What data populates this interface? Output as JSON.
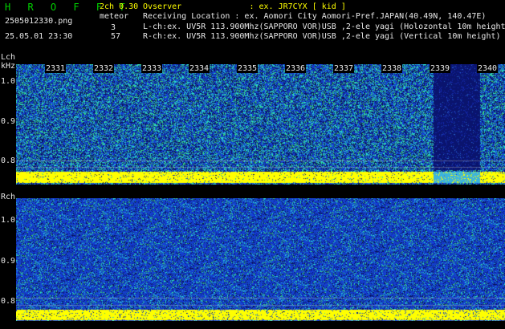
{
  "header": {
    "title": "H R O F F T",
    "mode": "2ch 0.30",
    "filename": "2505012330.png",
    "meteor_label": "meteor",
    "meteor_l": "3",
    "meteor_r": "57",
    "datetime": "25.05.01 23:30",
    "info_lines": [
      "Ovserver              : ex. JR7CYX [ kid ]",
      "Receiving Location : ex. Aomori City Aomori-Pref.JAPAN(40.49N, 140.47E)",
      "L-ch:ex. UV5R 113.900Mhz(SAPPORO VOR)USB ,2-ele yagi (Holozontal 10m height)",
      "R-ch:ex. UV5R 113.900Mhz(SAPPORO VOR)USB ,2-ele yagi (Vertical 10m height)"
    ]
  },
  "lch": {
    "label": "Lch",
    "unit": "kHz",
    "y_ticks": [
      "1.0",
      "0.9",
      "0.8"
    ],
    "x_ticks": [
      "2331",
      "2332",
      "2333",
      "2334",
      "2335",
      "2336",
      "2337",
      "2338",
      "2339",
      "2340"
    ]
  },
  "rch": {
    "label": "Rch",
    "y_ticks": [
      "1.0",
      "0.9",
      "0.8"
    ]
  },
  "colors": {
    "accent_green": "#00d000",
    "meteor_yellow": "#ffff00",
    "noise_blue": "#1a3cc8",
    "noise_cyan": "#30d0c0"
  }
}
